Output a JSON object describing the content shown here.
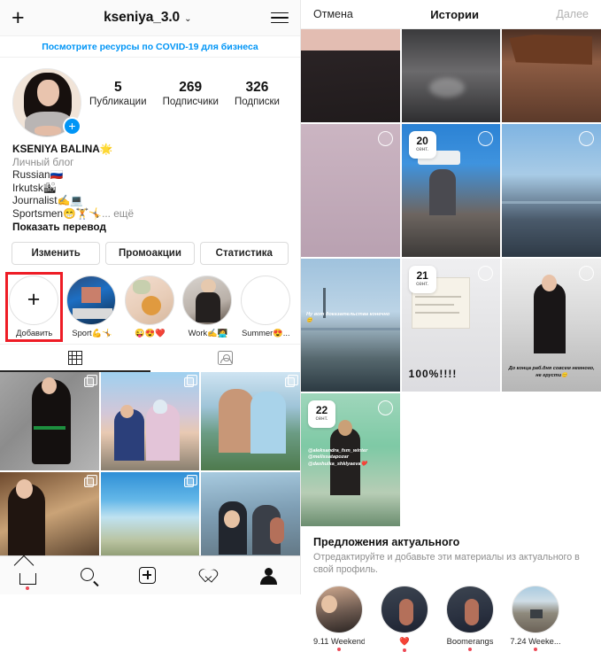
{
  "left": {
    "header": {
      "add_icon": "plus-icon",
      "username": "kseniya_3.0",
      "chevron": "⌄",
      "menu_icon": "hamburger-icon"
    },
    "banner": {
      "text": "Посмотрите ресурсы по COVID-19 для бизнеса"
    },
    "stats": [
      {
        "num": "5",
        "label": "Публикации"
      },
      {
        "num": "269",
        "label": "Подписчики"
      },
      {
        "num": "326",
        "label": "Подписки"
      }
    ],
    "bio": {
      "name": "KSENIYA BALINA🌟",
      "category": "Личный блог",
      "line1": "Russian🇷🇺",
      "line2": "Irkutsk🏙",
      "line3": "Journalist✍️💻",
      "line4": "Sportsmen😁🏋️🤸",
      "more": "... ещё",
      "translate": "Показать перевод"
    },
    "actions": [
      {
        "label": "Изменить"
      },
      {
        "label": "Промоакции"
      },
      {
        "label": "Статистика"
      }
    ],
    "highlights": [
      {
        "label": "Добавить",
        "type": "add",
        "highlighted": true
      },
      {
        "label": "Sport💪🤸",
        "type": "cover"
      },
      {
        "label": "😜😍❤️",
        "type": "cover"
      },
      {
        "label": "Work✍️🧑‍💻",
        "type": "cover"
      },
      {
        "label": "Summer😍...",
        "type": "cover"
      }
    ],
    "tabs": [
      {
        "icon": "grid-icon",
        "active": true
      },
      {
        "icon": "tagged-person-icon",
        "active": false
      }
    ],
    "bottom_nav": [
      {
        "icon": "home-icon",
        "active": true,
        "badge": true
      },
      {
        "icon": "search-icon",
        "active": false
      },
      {
        "icon": "add-post-icon",
        "active": false
      },
      {
        "icon": "heart-activity-icon",
        "active": false
      },
      {
        "icon": "profile-icon",
        "active": true
      }
    ]
  },
  "right": {
    "header": {
      "cancel": "Отмена",
      "title": "Истории",
      "next": "Далее"
    },
    "stories": [
      {
        "date_day": "",
        "date_month": "",
        "selected": false,
        "text": ""
      },
      {
        "date_day": "",
        "date_month": "",
        "selected": false,
        "text": ""
      },
      {
        "date_day": "",
        "date_month": "",
        "selected": false,
        "text": ""
      },
      {
        "date_day": "",
        "date_month": "",
        "selected": true,
        "text": "Ну вот доказательства конечно😊"
      },
      {
        "date_day": "20",
        "date_month": "сент.",
        "selected": true,
        "text": ""
      },
      {
        "date_day": "",
        "date_month": "",
        "selected": true,
        "text": ""
      },
      {
        "date_day": "21",
        "date_month": "сент.",
        "selected": true,
        "text": "100%!!!!"
      },
      {
        "date_day": "",
        "date_month": "",
        "selected": true,
        "text": "До конца раб.дня совсем немного, не грусти😊"
      },
      {
        "date_day": "22",
        "date_month": "сент.",
        "selected": true,
        "text": "@aleksandra_fsm_winter @melissatapozar @dashulka_shklyaeva❤️"
      }
    ],
    "suggestions": {
      "title": "Предложения актуального",
      "subtitle": "Отредактируйте и добавьте эти материалы из актуального в свой профиль.",
      "items": [
        {
          "label": "9.11 Weekend",
          "dot": true
        },
        {
          "label": "❤️",
          "dot": true
        },
        {
          "label": "Boomerangs",
          "dot": true
        },
        {
          "label": "7.24 Weeke...",
          "dot": true
        }
      ]
    }
  },
  "colors": {
    "accent_blue": "#0095f6",
    "highlight_red": "#ee1c25",
    "badge_red": "#ed4956",
    "text_primary": "#262626",
    "text_muted": "#8e8e8e"
  }
}
